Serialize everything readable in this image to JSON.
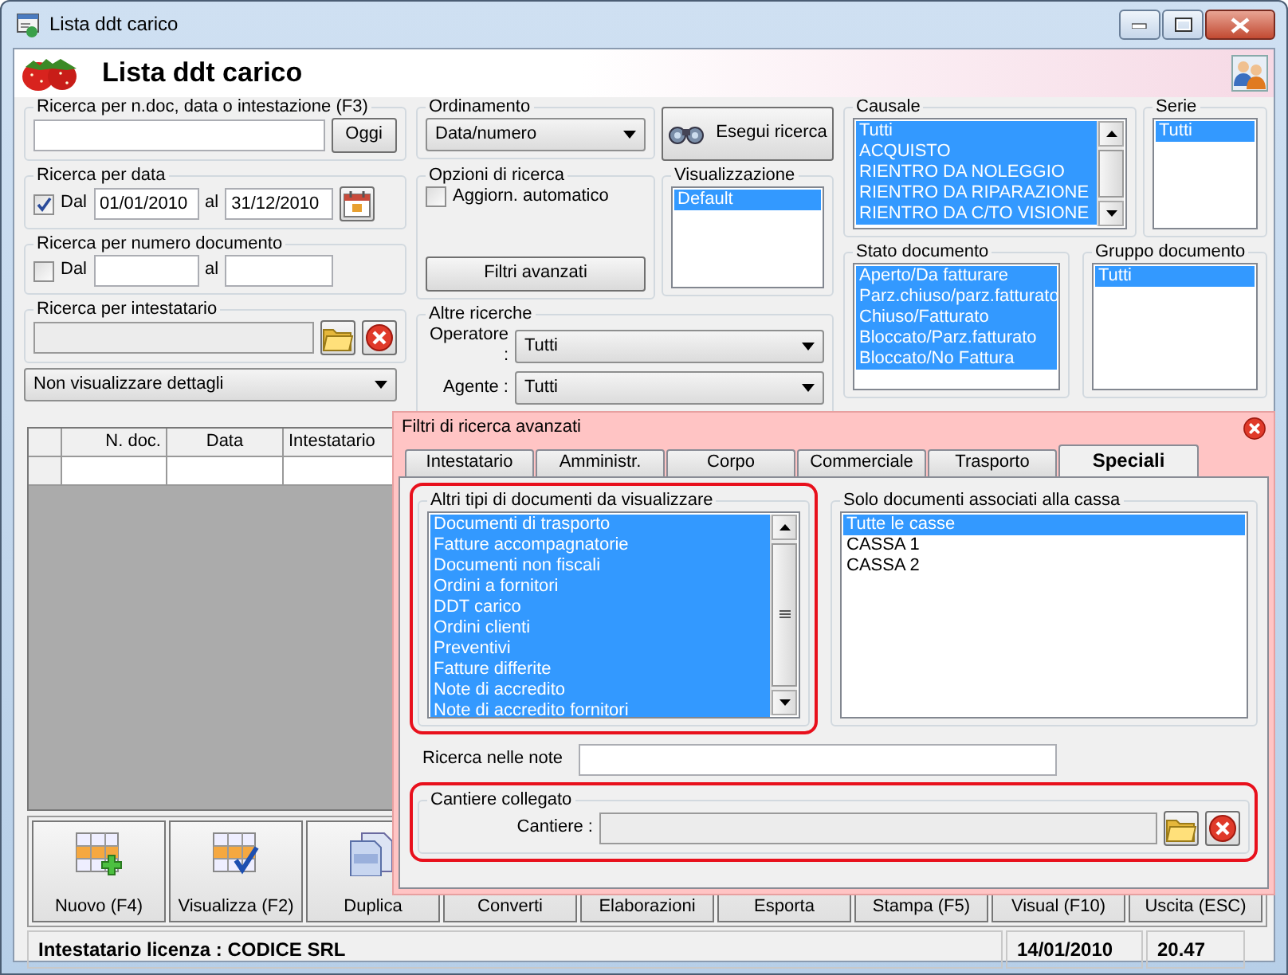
{
  "window": {
    "title": "Lista ddt carico"
  },
  "header": {
    "title": "Lista ddt carico"
  },
  "quick_search": {
    "label": "Ricerca per n.doc, data o intestazione (F3)",
    "button": "Oggi"
  },
  "date_search": {
    "label": "Ricerca per data",
    "checked": true,
    "from_label": "Dal",
    "from": "01/01/2010",
    "to_label": "al",
    "to": "31/12/2010"
  },
  "number_search": {
    "label": "Ricerca per numero documento",
    "checked": false,
    "from_label": "Dal",
    "to_label": "al"
  },
  "holder_search": {
    "label": "Ricerca per intestatario",
    "disabled": true
  },
  "detail_select": {
    "value": "Non visualizzare dettagli"
  },
  "sorting": {
    "label": "Ordinamento",
    "value": "Data/numero"
  },
  "run_search_button": "Esegui ricerca",
  "options": {
    "label": "Opzioni di ricerca",
    "auto_update": {
      "label": "Aggiorn. automatico",
      "checked": false
    },
    "advanced_button": "Filtri avanzati"
  },
  "view": {
    "label": "Visualizzazione",
    "items": [
      {
        "label": "Default",
        "selected": true
      }
    ]
  },
  "other_searches": {
    "label": "Altre ricerche",
    "fields": [
      {
        "label": "Operatore :",
        "value": "Tutti"
      },
      {
        "label": "Agente :",
        "value": "Tutti"
      }
    ]
  },
  "causale": {
    "label": "Causale",
    "items": [
      {
        "label": "Tutti",
        "selected": true
      },
      {
        "label": "ACQUISTO",
        "selected": true
      },
      {
        "label": "RIENTRO DA NOLEGGIO",
        "selected": true
      },
      {
        "label": "RIENTRO DA RIPARAZIONE",
        "selected": true
      },
      {
        "label": "RIENTRO DA C/TO VISIONE",
        "selected": true
      }
    ]
  },
  "serie": {
    "label": "Serie",
    "items": [
      {
        "label": "Tutti",
        "selected": true
      }
    ]
  },
  "stato": {
    "label": "Stato documento",
    "items": [
      {
        "label": "Aperto/Da fatturare",
        "selected": true
      },
      {
        "label": "Parz.chiuso/parz.fatturato",
        "selected": true
      },
      {
        "label": "Chiuso/Fatturato",
        "selected": true
      },
      {
        "label": "Bloccato/Parz.fatturato",
        "selected": true
      },
      {
        "label": "Bloccato/No Fattura",
        "selected": true
      }
    ]
  },
  "gruppo": {
    "label": "Gruppo documento",
    "items": [
      {
        "label": "Tutti",
        "selected": true
      }
    ]
  },
  "table": {
    "columns": [
      "N. doc.",
      "Data",
      "Intestatario"
    ]
  },
  "toolbar": [
    {
      "label": "Nuovo (F4)",
      "kind": "new"
    },
    {
      "label": "Visualizza (F2)",
      "kind": "view"
    },
    {
      "label": "Duplica",
      "kind": "copy"
    },
    {
      "label": "Converti",
      "kind": "plain"
    },
    {
      "label": "Elaborazioni",
      "kind": "plain"
    },
    {
      "label": "Esporta",
      "kind": "plain"
    },
    {
      "label": "Stampa (F5)",
      "kind": "plain"
    },
    {
      "label": "Visual (F10)",
      "kind": "plain"
    },
    {
      "label": "Uscita (ESC)",
      "kind": "plain"
    }
  ],
  "status_bar": {
    "license": "Intestatario licenza : CODICE SRL",
    "date": "14/01/2010",
    "time": "20.47"
  },
  "advanced_filters": {
    "title": "Filtri di ricerca avanzati",
    "tabs": [
      {
        "label": "Intestatario",
        "selected": false
      },
      {
        "label": "Amministr.",
        "selected": false
      },
      {
        "label": "Corpo",
        "selected": false
      },
      {
        "label": "Commerciale",
        "selected": false
      },
      {
        "label": "Trasporto",
        "selected": false
      },
      {
        "label": "Speciali",
        "selected": true
      }
    ],
    "doc_types": {
      "label": "Altri tipi di documenti da visualizzare",
      "items": [
        {
          "label": "Documenti di trasporto",
          "selected": true
        },
        {
          "label": "Fatture accompagnatorie",
          "selected": true
        },
        {
          "label": "Documenti non fiscali",
          "selected": true
        },
        {
          "label": "Ordini a fornitori",
          "selected": true
        },
        {
          "label": "DDT carico",
          "selected": true
        },
        {
          "label": "Ordini clienti",
          "selected": true
        },
        {
          "label": "Preventivi",
          "selected": true
        },
        {
          "label": "Fatture differite",
          "selected": true
        },
        {
          "label": "Note di accredito",
          "selected": true
        },
        {
          "label": "Note di accredito fornitori",
          "selected": true
        }
      ]
    },
    "cash": {
      "label": "Solo documenti associati alla cassa",
      "items": [
        {
          "label": "Tutte le casse",
          "selected": true
        },
        {
          "label": "CASSA 1",
          "selected": false
        },
        {
          "label": "CASSA 2",
          "selected": false
        }
      ]
    },
    "notes": {
      "label": "Ricerca nelle note"
    },
    "site": {
      "label": "Cantiere collegato",
      "field_label": "Cantiere :",
      "disabled": true
    }
  }
}
